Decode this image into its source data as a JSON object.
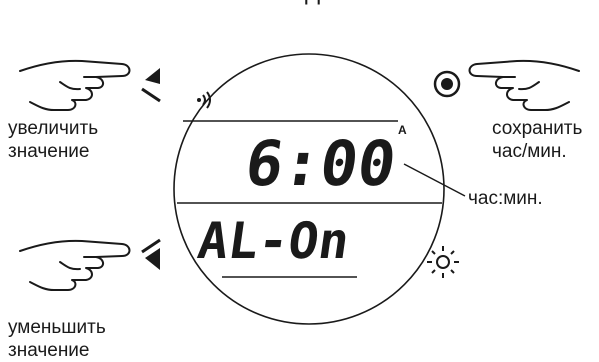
{
  "diagram": {
    "top_cut_text": "д",
    "display": {
      "time": "6:00",
      "am_pm_indicator": "A",
      "alarm_status": "AL-On",
      "alarm_sound_icon": "sound-waves-icon",
      "backlight_icon": "sun-icon"
    },
    "labels": {
      "increase": [
        "увеличить",
        "значение"
      ],
      "decrease": [
        "уменьшить",
        "значение"
      ],
      "save": [
        "сохранить",
        "час/мин."
      ],
      "time_callout": "час:мин."
    },
    "icons": {
      "up_button": "up-triangle-icon",
      "down_button": "down-triangle-icon",
      "save_button": "circle-dot-icon",
      "pointer": "pointing-hand-icon"
    },
    "colors": {
      "ink": "#1a1a1a",
      "background": "#ffffff"
    }
  }
}
